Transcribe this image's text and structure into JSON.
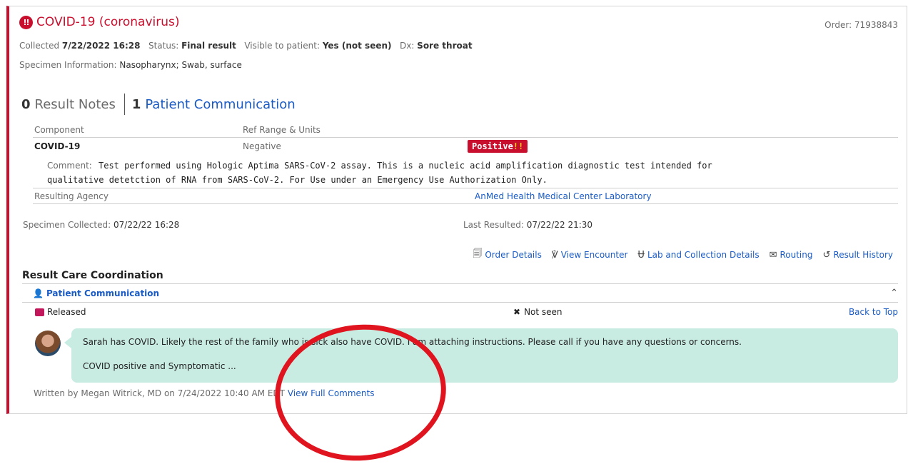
{
  "header": {
    "title": "COVID-19 (coronavirus)",
    "order": "Order: 71938843",
    "collected_label": "Collected",
    "collected_value": "7/22/2022 16:28",
    "status_label": "Status:",
    "status_value": "Final result",
    "visible_label": "Visible to patient:",
    "visible_value": "Yes (not seen)",
    "dx_label": "Dx:",
    "dx_value": "Sore throat",
    "specimen_label": "Specimen Information:",
    "specimen_value": "Nasopharynx; Swab, surface"
  },
  "notes": {
    "result_notes_count": "0",
    "result_notes_label": "Result Notes",
    "patient_comm_count": "1",
    "patient_comm_label": "Patient Communication"
  },
  "results_table": {
    "col_component": "Component",
    "col_ref_range": "Ref Range & Units",
    "component": "COVID-19",
    "ref_range": "Negative",
    "value": "Positive",
    "value_flag": "!!",
    "comment_label": "Comment:",
    "comment_line1": "Test performed using Hologic Aptima SARS-CoV-2 assay. This is a nucleic acid amplification diagnostic test intended for",
    "comment_line2": "qualitative detetction of RNA from SARS-CoV-2. For Use under an Emergency Use Authorization Only.",
    "resulting_agency_label": "Resulting Agency",
    "resulting_agency_value": "AnMed Health Medical Center Laboratory"
  },
  "dates": {
    "specimen_collected_label": "Specimen Collected:",
    "specimen_collected_value": "07/22/22 16:28",
    "last_resulted_label": "Last Resulted:",
    "last_resulted_value": "07/22/22 21:30"
  },
  "toolbar": {
    "order_details": "Order Details",
    "view_encounter": "View Encounter",
    "lab_collection": "Lab and Collection Details",
    "routing": "Routing",
    "result_history": "Result History"
  },
  "coordination": {
    "heading": "Result Care Coordination",
    "patient_comm": "Patient Communication",
    "released": "Released",
    "not_seen": "Not seen",
    "back_to_top": "Back to Top",
    "message_line1": "Sarah has COVID. Likely the rest of the family who is sick also have COVID. I am attaching instructions. Please call if you have any questions or concerns.",
    "message_line2": "COVID positive and Symptomatic  ...",
    "written_by": "Written by Megan Witrick, MD on 7/24/2022 10:40 AM EDT",
    "view_full_comments": "View Full Comments"
  },
  "icons": {
    "alert": "alert-icon",
    "order_details": "document-icon",
    "view_encounter": "stethoscope-icon",
    "lab": "test-tube-icon",
    "routing": "envelope-arrow-icon",
    "history": "history-icon",
    "patient_comm": "person-speech-icon",
    "released": "released-icon",
    "not_seen": "x-icon",
    "collapse": "double-chevron-up-icon"
  },
  "colors": {
    "accent_red": "#c8102e",
    "link_blue": "#1a5bc4",
    "bubble_green": "#c9ece2",
    "annotation_red": "#e0141e"
  }
}
